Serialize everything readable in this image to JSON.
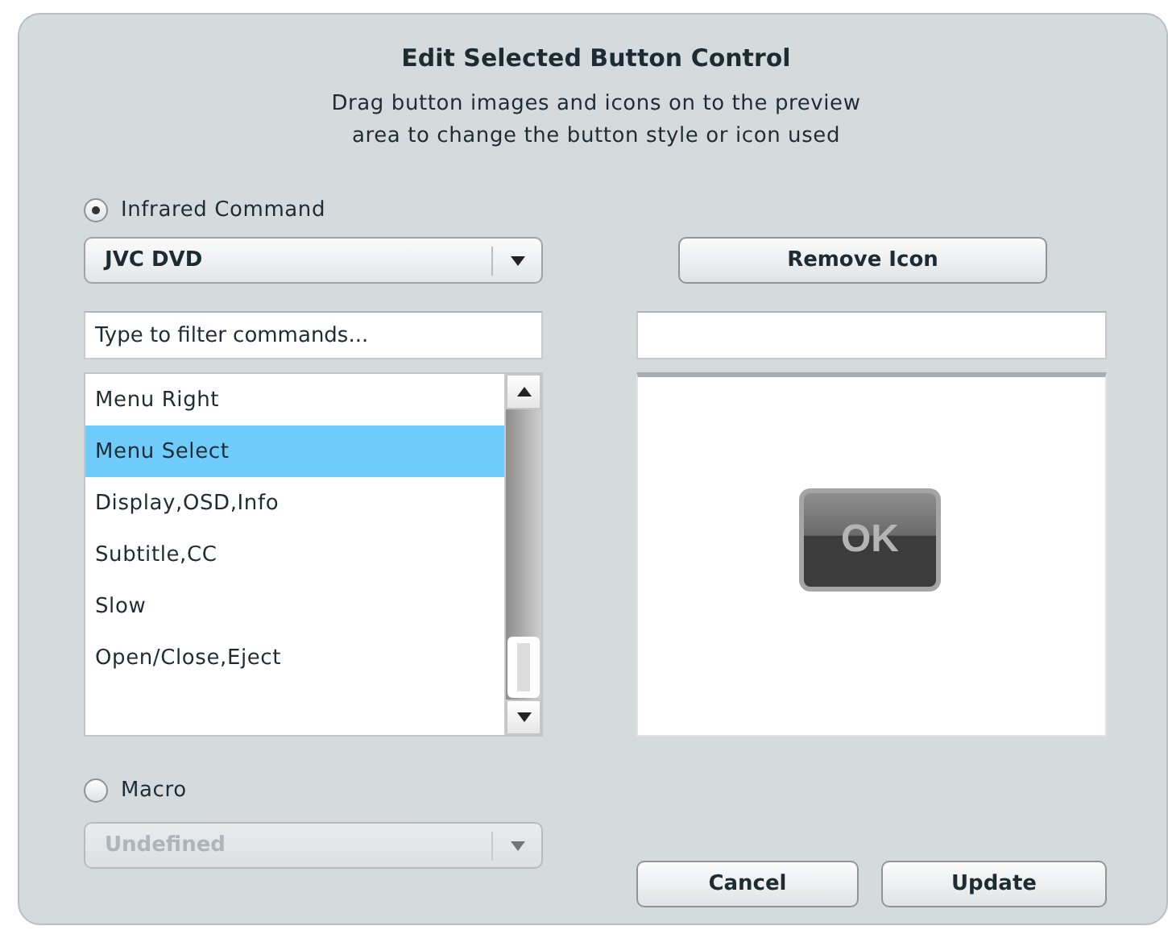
{
  "dialog": {
    "title": "Edit Selected Button Control",
    "description": "Drag button images and icons on to the preview area to change the button style or icon used"
  },
  "source_options": [
    {
      "kind": "infrared",
      "label": "Infrared Command",
      "selected": true
    },
    {
      "kind": "macro",
      "label": "Macro",
      "selected": false
    }
  ],
  "device_select": {
    "value": "JVC DVD",
    "disabled": false
  },
  "filter_field": {
    "placeholder": "Type to filter commands..."
  },
  "commands": [
    {
      "label": "Menu Right",
      "selected": false
    },
    {
      "label": "Menu Select",
      "selected": true
    },
    {
      "label": "Display,OSD,Info",
      "selected": false
    },
    {
      "label": "Subtitle,CC",
      "selected": false
    },
    {
      "label": "Slow",
      "selected": false
    },
    {
      "label": "Open/Close,Eject",
      "selected": false
    }
  ],
  "remove_icon_button": "Remove Icon",
  "preview": {
    "icon_label": "OK"
  },
  "macro_select": {
    "value": "Undefined",
    "disabled": true
  },
  "buttons": [
    "Cancel",
    "Update"
  ]
}
